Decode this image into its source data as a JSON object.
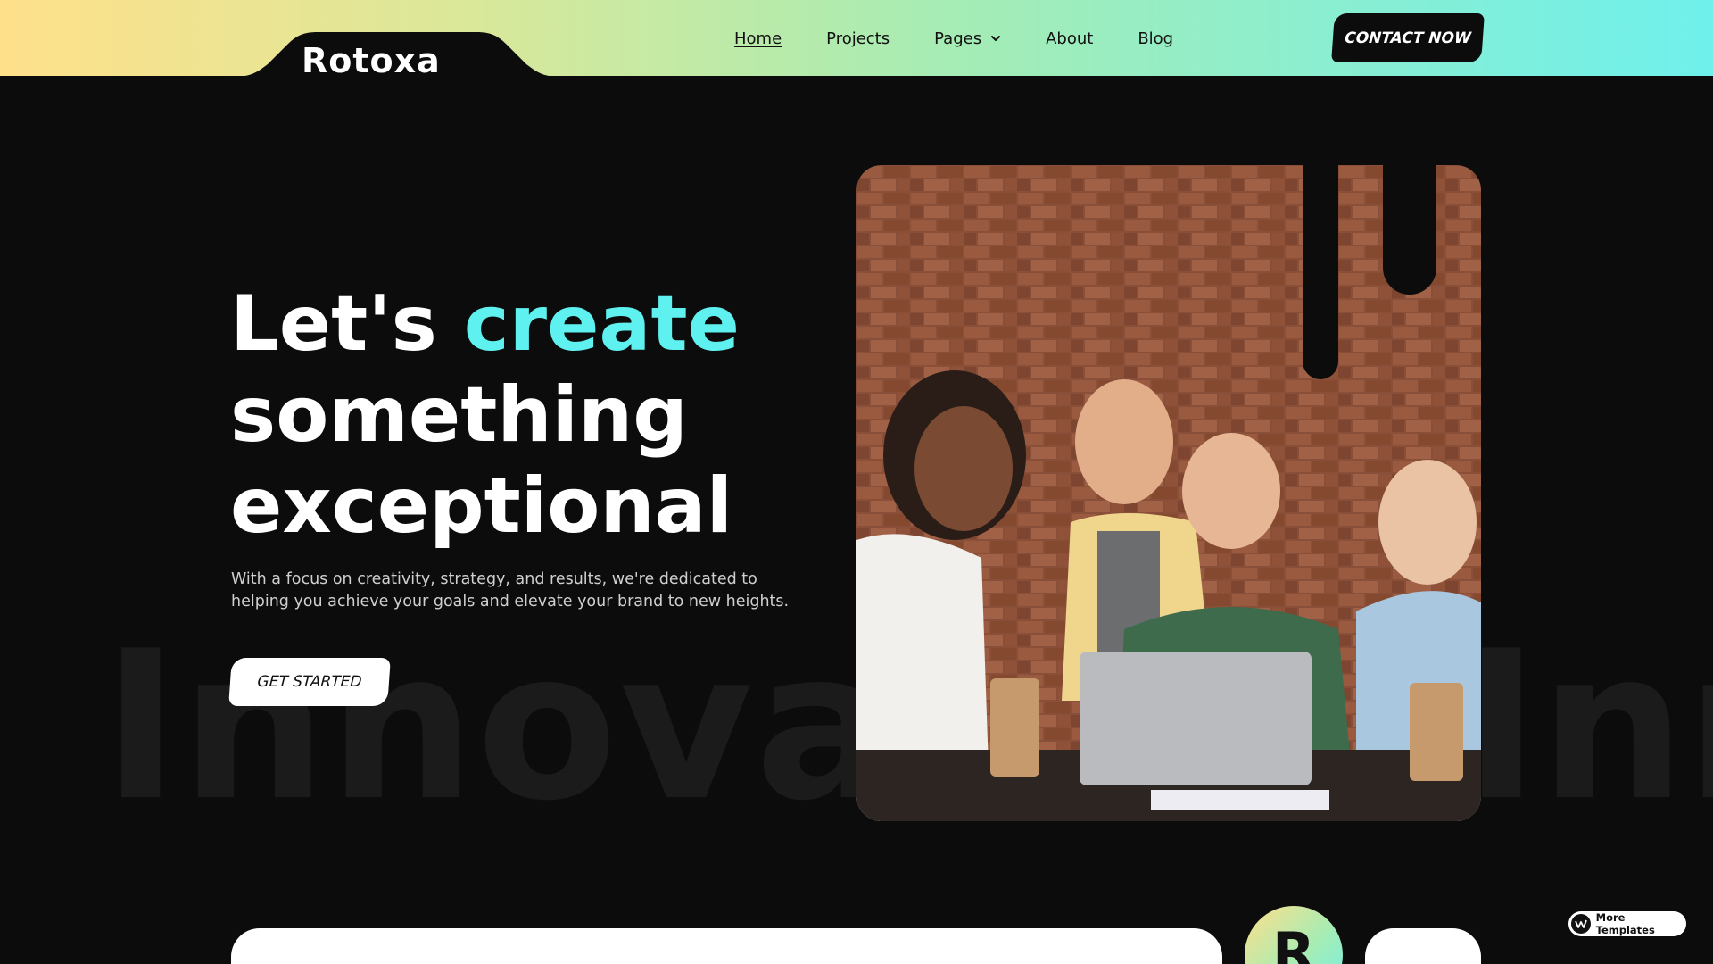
{
  "brand": {
    "logo_text": "Rotoxa"
  },
  "nav": {
    "items": [
      {
        "label": "Home",
        "active": true
      },
      {
        "label": "Projects"
      },
      {
        "label": "Pages",
        "has_dropdown": true
      },
      {
        "label": "About"
      },
      {
        "label": "Blog"
      }
    ],
    "contact_label": "CONTACT NOW"
  },
  "hero": {
    "title_part1": "Let's ",
    "title_accent": "create",
    "title_part2": "something exceptional",
    "description": "With a focus on creativity, strategy, and results, we're dedicated to helping you achieve your goals and elevate your brand to new heights.",
    "cta_label": "GET STARTED",
    "background_word": "Innovat",
    "background_word_2": "Inno",
    "image_description_icon": "team-celebration-photo"
  },
  "bottom": {
    "badge_letter": "R"
  },
  "badge": {
    "label": "More Templates"
  },
  "colors": {
    "background": "#0c0c0c",
    "accent": "#5ff0f0",
    "header_gradient": [
      "#ffe08a",
      "#a6ecb4",
      "#6ff0ec"
    ]
  }
}
